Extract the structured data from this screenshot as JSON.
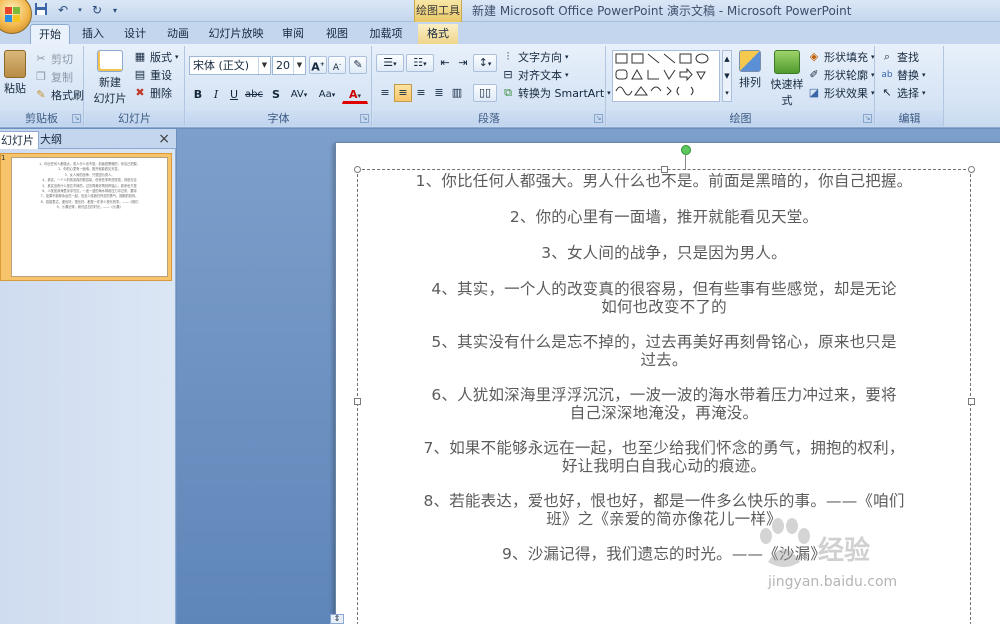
{
  "window": {
    "title": "新建 Microsoft Office PowerPoint 演示文稿 - Microsoft PowerPoint",
    "context_tab_title": "绘图工具"
  },
  "quick_access": [
    "save-icon",
    "undo-icon",
    "redo-icon",
    "customize-icon"
  ],
  "tabs": [
    {
      "label": "开始",
      "active": true
    },
    {
      "label": "插入"
    },
    {
      "label": "设计"
    },
    {
      "label": "动画"
    },
    {
      "label": "幻灯片放映"
    },
    {
      "label": "审阅"
    },
    {
      "label": "视图"
    },
    {
      "label": "加载项"
    },
    {
      "label": "格式",
      "contextual": true
    }
  ],
  "ribbon": {
    "clipboard": {
      "label": "剪贴板",
      "paste": "粘贴",
      "cut": "剪切",
      "copy": "复制",
      "format_painter": "格式刷"
    },
    "slides": {
      "label": "幻灯片",
      "new_slide_line1": "新建",
      "new_slide_line2": "幻灯片",
      "layout": "版式",
      "reset": "重设",
      "delete": "删除"
    },
    "font": {
      "label": "字体",
      "font_name": "宋体 (正文)",
      "font_size": "20",
      "bold": "B",
      "italic": "I",
      "underline": "U",
      "strike": "abc",
      "shadow": "S",
      "spacing": "AV",
      "case": "Aa",
      "color": "A",
      "grow": "A",
      "shrink": "A"
    },
    "paragraph": {
      "label": "段落",
      "text_direction": "文字方向",
      "align_text": "对齐文本",
      "convert_smartart": "转换为 SmartArt"
    },
    "drawing": {
      "label": "绘图",
      "arrange": "排列",
      "quick_styles": "快速样式",
      "shape_fill": "形状填充",
      "shape_outline": "形状轮廓",
      "shape_effects": "形状效果"
    },
    "editing": {
      "label": "编辑",
      "find": "查找",
      "replace": "替换",
      "select": "选择"
    }
  },
  "left_pane": {
    "tab_slides": "幻灯片",
    "tab_outline": "大纲",
    "close": "×",
    "thumb_number": "1"
  },
  "slide": {
    "paragraphs": [
      {
        "lines": [
          "1、你比任何人都强大。男人什么也不是。前面是黑暗的，你自己把握。"
        ]
      },
      {
        "lines": [
          "2、你的心里有一面墙，推开就能看见天堂。"
        ]
      },
      {
        "lines": [
          "3、女人间的战争，只是因为男人。"
        ]
      },
      {
        "lines": [
          "4、其实，一个人的改变真的很容易，但有些事有些感觉，却是无论",
          "如何也改变不了的"
        ]
      },
      {
        "lines": [
          "5、其实没有什么是忘不掉的，过去再美好再刻骨铭心，原来也只是",
          "过去。"
        ]
      },
      {
        "lines": [
          "6、人犹如深海里浮浮沉沉，一波一波的海水带着压力冲过来，要将",
          "自己深深地淹没，再淹没。"
        ]
      },
      {
        "lines": [
          "7、如果不能够永远在一起，也至少给我们怀念的勇气，拥抱的权利，",
          "好让我明白自我心动的痕迹。"
        ]
      },
      {
        "lines": [
          "8、若能表达，爱也好，恨也好，都是一件多么快乐的事。——《咱们",
          "班》之《亲爱的简亦像花儿一样》"
        ]
      },
      {
        "lines": [
          "9、沙漏记得，我们遗忘的时光。——《沙漏》"
        ]
      }
    ]
  },
  "watermark": {
    "brand": "经验",
    "url": "jingyan.baidu.com"
  }
}
